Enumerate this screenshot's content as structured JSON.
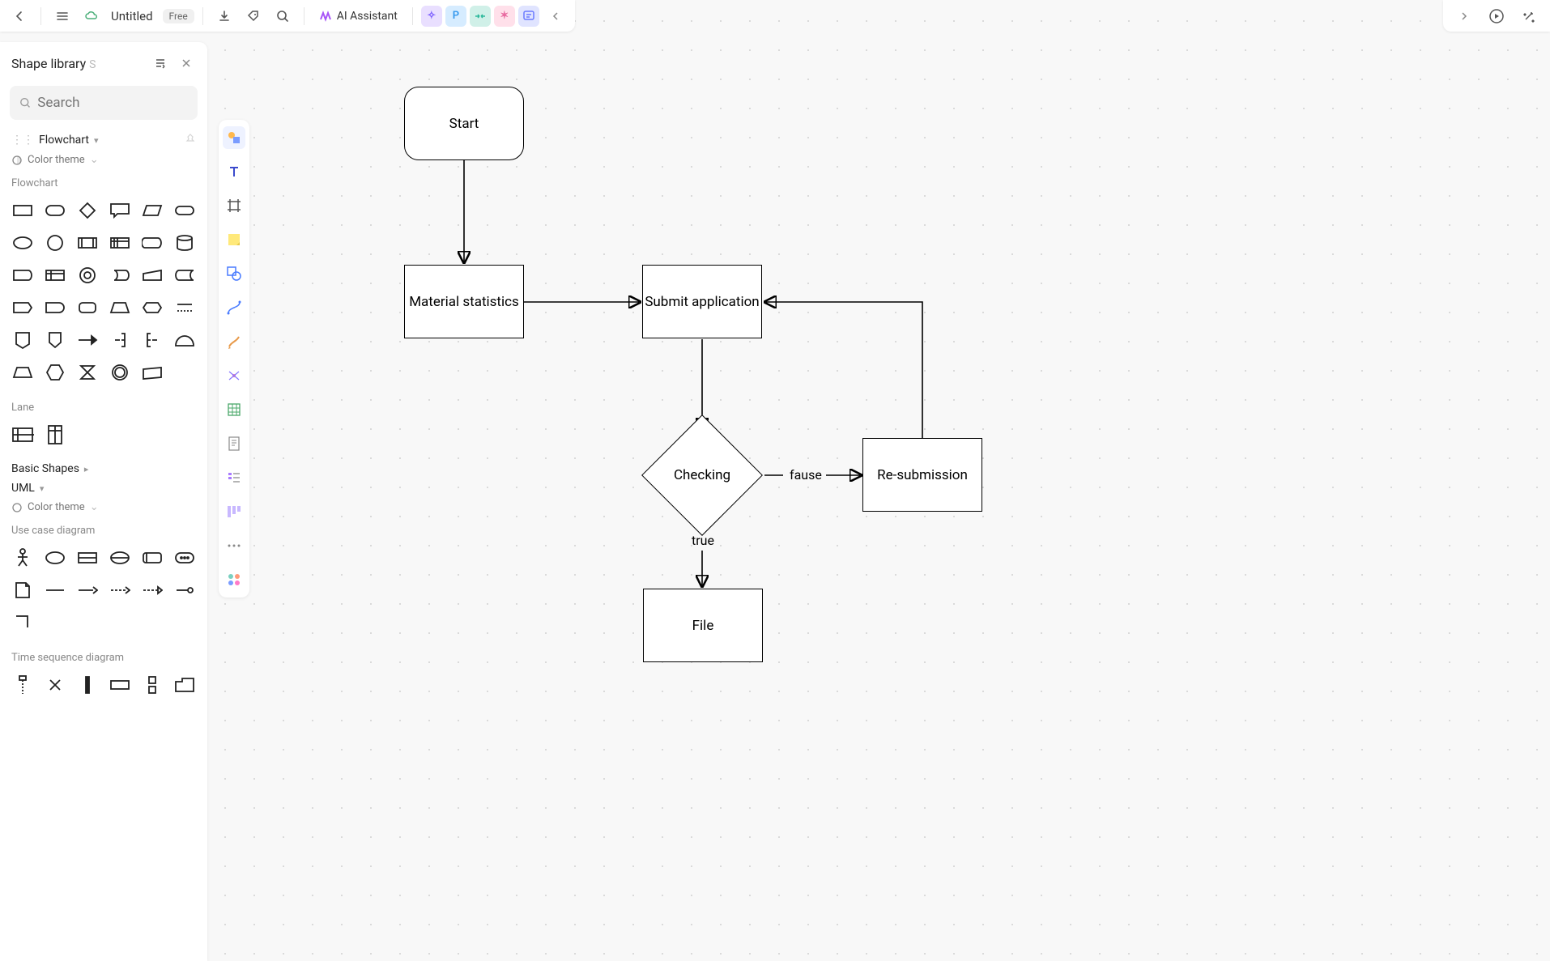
{
  "header": {
    "doc_title": "Untitled",
    "plan_badge": "Free",
    "ai_label": "AI Assistant",
    "chips": [
      "✧",
      "P",
      "⇄",
      "✶",
      "✉"
    ]
  },
  "sidebar": {
    "title": "Shape library",
    "title_key": "S",
    "search_placeholder": "Search",
    "sections": {
      "flowchart": "Flowchart",
      "color_theme": "Color theme",
      "flowchart_cat": "Flowchart",
      "lane_cat": "Lane",
      "basic_shapes": "Basic Shapes",
      "uml": "UML",
      "use_case": "Use case diagram",
      "time_seq": "Time sequence diagram"
    }
  },
  "flow": {
    "start": "Start",
    "material": "Material statistics",
    "submit": "Submit application",
    "checking": "Checking",
    "resubmit": "Re-submission",
    "file": "File",
    "edge_false": "fause",
    "edge_true": "true"
  }
}
